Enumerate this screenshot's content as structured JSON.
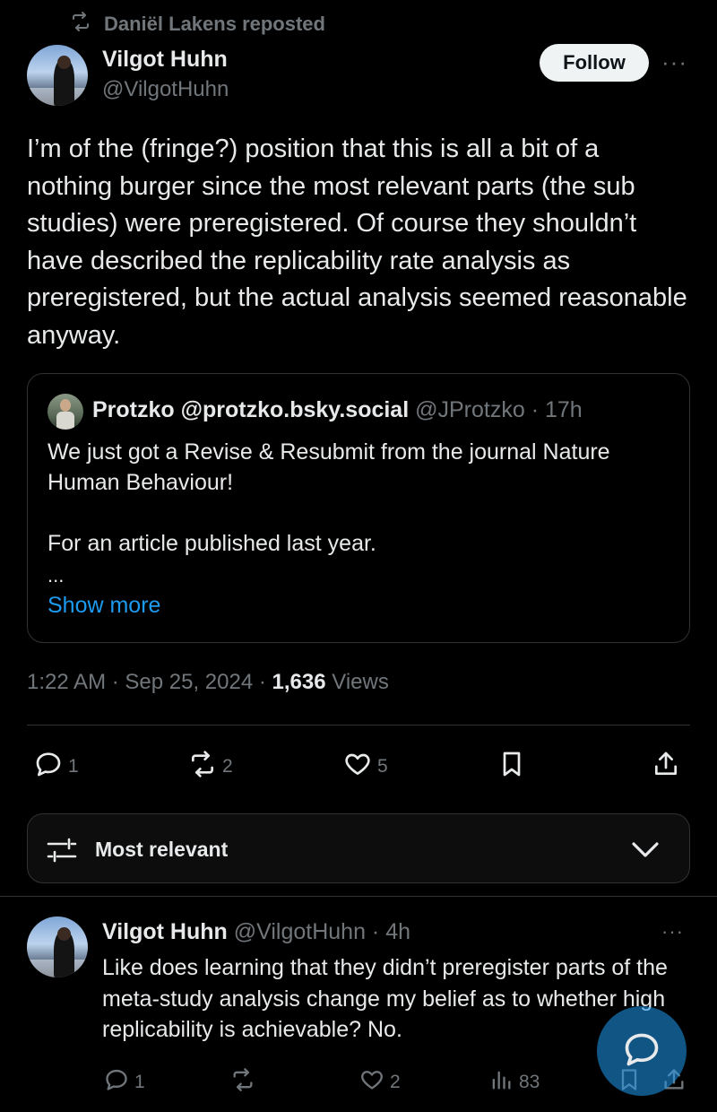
{
  "repost": {
    "label": "Daniël Lakens reposted"
  },
  "tweet": {
    "author_name": "Vilgot Huhn",
    "author_handle": "@VilgotHuhn",
    "follow_label": "Follow",
    "more": "···",
    "text": "I’m of the (fringe?) position that this is all a bit of a nothing burger since the most relevant parts (the sub studies) were preregistered. Of course they shouldn’t have described the replicability rate analysis as preregistered, but the actual analysis seemed reasonable anyway.",
    "time": "1:22 AM · Sep 25, 2024 · ",
    "views_count": "1,636",
    "views_label": " Views",
    "stats": {
      "replies": "1",
      "reposts": "2",
      "likes": "5"
    }
  },
  "quote": {
    "name": "Protzko @protzko.bsky.social",
    "handle_time": " @JProtzko · 17h",
    "line1": "We just got a Revise & Resubmit from the journal Nature Human Behaviour!",
    "line2": "For an article published last year.",
    "ellipsis": "...",
    "show_more": "Show more"
  },
  "sort": {
    "label": "Most relevant"
  },
  "reply": {
    "name": "Vilgot Huhn",
    "handle_time": " @VilgotHuhn · 4h",
    "more": "···",
    "text": "Like does learning that they didn’t preregister parts of the meta-study analysis change my belief as to whether high replicability is achievable? No.",
    "stats": {
      "replies": "1",
      "likes": "2",
      "views": "83"
    }
  },
  "colors": {
    "background": "#000000",
    "text": "#e7e9ea",
    "muted": "#71767b",
    "link": "#1d9bf0",
    "border": "#2f3336"
  }
}
